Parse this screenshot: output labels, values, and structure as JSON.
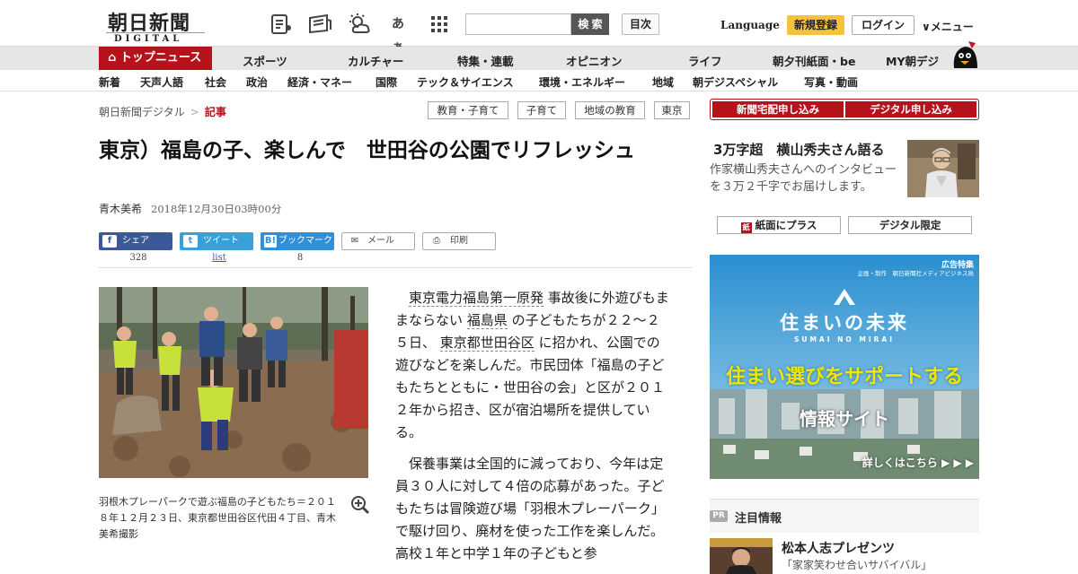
{
  "header": {
    "logo_main": "朝日新聞",
    "logo_sub": "DIGITAL",
    "search_placeholder": "",
    "search_button": "検 索",
    "toc_button": "目次",
    "language": "Language",
    "register": "新規登録",
    "login": "ログイン",
    "menu": "メニュー",
    "font_size_icon_label": "あぁ"
  },
  "global_nav": {
    "items": [
      "トップニュース",
      "スポーツ",
      "カルチャー",
      "特集・連載",
      "オピニオン",
      "ライフ",
      "朝夕刊紙面・be",
      "MY朝デジ"
    ]
  },
  "sub_nav": {
    "items": [
      "新着",
      "天声人語",
      "社会",
      "政治",
      "経済・マネー",
      "国際",
      "テック＆サイエンス",
      "環境・エネルギー",
      "地域",
      "朝デジスペシャル",
      "写真・動画"
    ]
  },
  "breadcrumb": {
    "home": "朝日新聞デジタル",
    "separator": ">",
    "current": "記事"
  },
  "tags": [
    "教育・子育て",
    "子育て",
    "地域の教育",
    "東京"
  ],
  "article": {
    "title": "東京）福島の子、楽しんで　世田谷の公園でリフレッシュ",
    "author": "青木美希",
    "date": "2018年12月30日03時00分",
    "caption": "羽根木プレーパークで遊ぶ福島の子どもたち＝２０１８年１２月２３日、東京都世田谷区代田４丁目、青木美希撮影",
    "p1_link1": "東京電力福島第一原発",
    "p1_t1": "事故後に外遊びもままならない",
    "p1_link2": "福島県",
    "p1_t2": "の子どもたちが２２～２５日、",
    "p1_link3": "東京都世田谷区",
    "p1_t3": "に招かれ、公園での遊びなどを楽しんだ。市民団体「福島の子どもたちとともに・世田谷の会」と区が２０１２年から招き、区が宿泊場所を提供している。",
    "p2": "保養事業は全国的に減っており、今年は定員３０人に対して４倍の応募があった。子どもたちは冒険遊び場「羽根木プレーパーク」で駆け回り、廃材を使った工作を楽しんだ。高校１年と中学１年の子どもと参"
  },
  "share": {
    "facebook": {
      "label": "シェア",
      "count": "328"
    },
    "twitter": {
      "label": "ツイート",
      "count": "list"
    },
    "hatena": {
      "label": "ブックマーク",
      "count": "8"
    },
    "mail": "メール",
    "print": "印刷"
  },
  "sidebar": {
    "btn_delivery": "新聞宅配申し込み",
    "btn_digital": "デジタル申し込み",
    "promo_title": "3万字超　横山秀夫さん語る",
    "promo_desc": "作家横山秀夫さんへのインタビューを３万２千字でお届けします。",
    "paper_plus": "紙面にプラス",
    "digital_only": "デジタル限定",
    "pr_badge": "PR",
    "pr_heading": "注目情報",
    "pr_item_title": "松本人志プレゼンツ",
    "pr_item_desc": "「家家笑わせ合いサバイバル」"
  },
  "ad": {
    "label": "広告特集",
    "sponsor": "企画・制作　朝日新聞社メディアビジネス局",
    "main_title": "住まいの未来",
    "main_title_en": "SUMAI NO MIRAI",
    "headline": "住まい選びをサポートする",
    "subline": "情報サイト",
    "cta": "詳しくはこちら ▶ ▶ ▶"
  },
  "colors": {
    "brand_red": "#b5121b",
    "register_yellow": "#f5c33b",
    "facebook": "#3b5998",
    "twitter": "#3aa1d8",
    "hatena": "#2f8fd8"
  }
}
